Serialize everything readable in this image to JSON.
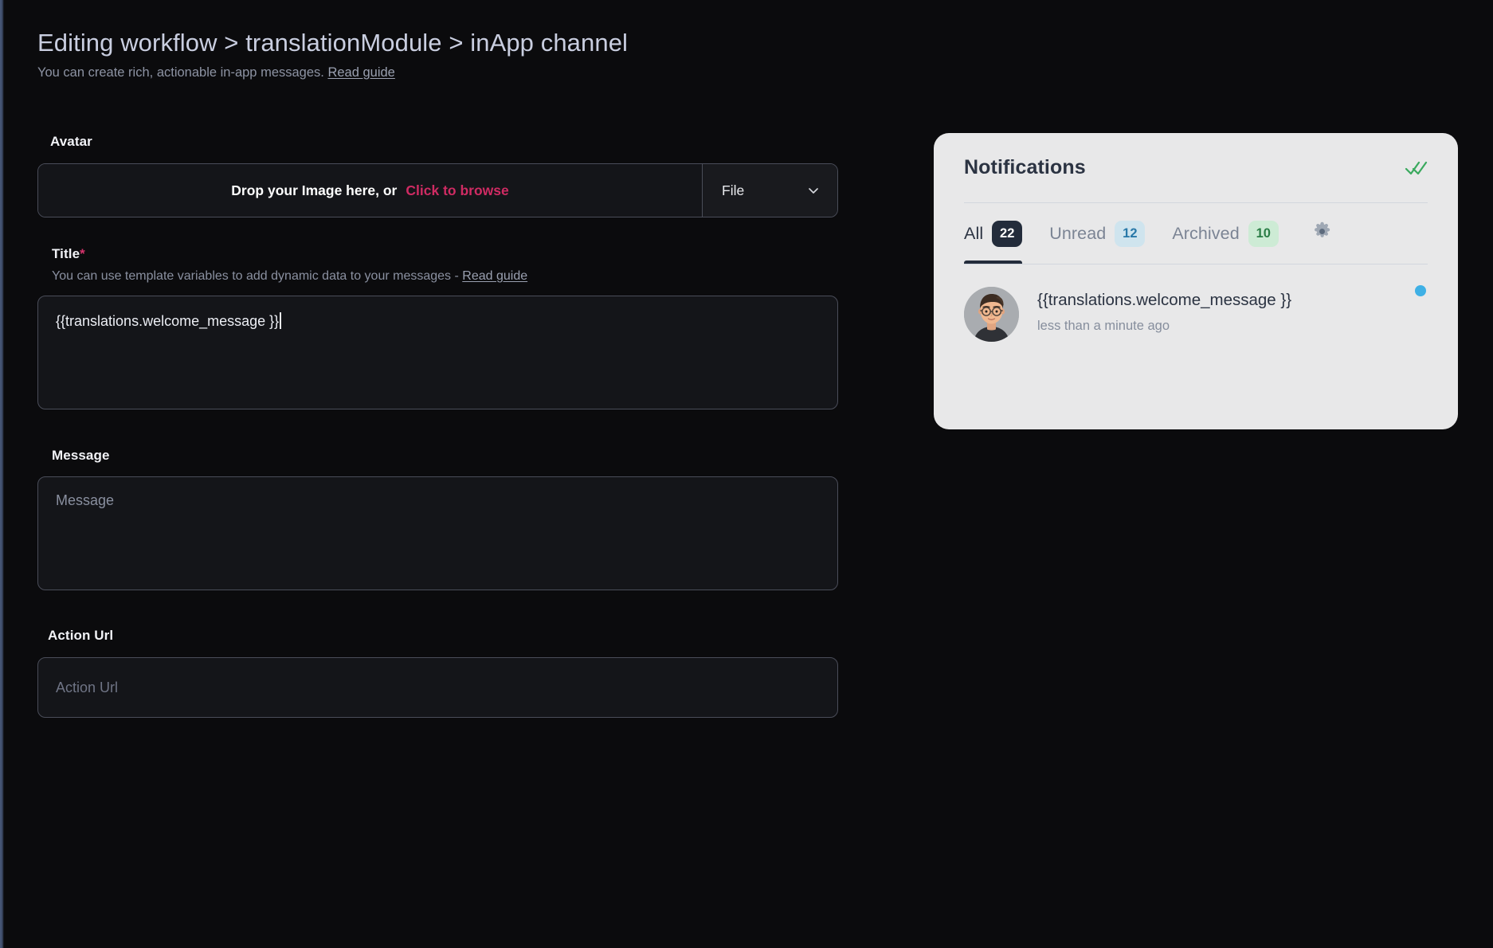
{
  "header": {
    "breadcrumb": "Editing workflow > translationModule > inApp channel",
    "subtitle_text": "You can create rich, actionable in-app messages.",
    "subtitle_link": "Read guide"
  },
  "form": {
    "avatar": {
      "label": "Avatar",
      "dropzone_text": "Drop your Image here, or",
      "dropzone_browse": "Click to browse",
      "select_value": "File",
      "select_icon": "chevron-down-icon"
    },
    "title": {
      "label": "Title",
      "required_mark": "*",
      "help_text": "You can use template variables to add dynamic data to your messages -",
      "help_link": "Read guide",
      "value": "{{translations.welcome_message }}"
    },
    "message": {
      "label": "Message",
      "placeholder": "Message",
      "value": ""
    },
    "action_url": {
      "label": "Action Url",
      "placeholder": "Action Url",
      "value": ""
    }
  },
  "preview": {
    "panel_title": "Notifications",
    "mark_all_read_icon": "double-check-icon",
    "settings_icon": "gear-icon",
    "tabs": [
      {
        "label": "All",
        "count": "22",
        "active": true
      },
      {
        "label": "Unread",
        "count": "12",
        "active": false
      },
      {
        "label": "Archived",
        "count": "10",
        "active": false
      }
    ],
    "items": [
      {
        "avatar_icon": "user-avatar-image",
        "text": "{{translations.welcome_message }}",
        "time": "less than a minute ago",
        "unread": true
      }
    ]
  },
  "colors": {
    "page_background": "#0b0b0d",
    "accent_pink": "#cf2b63",
    "panel_background": "#e8e8e9",
    "badge_all": "#232c3b",
    "badge_unread_bg": "#cfe4ee",
    "badge_unread_text": "#2878a8",
    "badge_archived_bg": "#cdebd5",
    "badge_archived_text": "#2a7d46",
    "unread_dot": "#3fb0e5",
    "check_green": "#3aa95e"
  }
}
